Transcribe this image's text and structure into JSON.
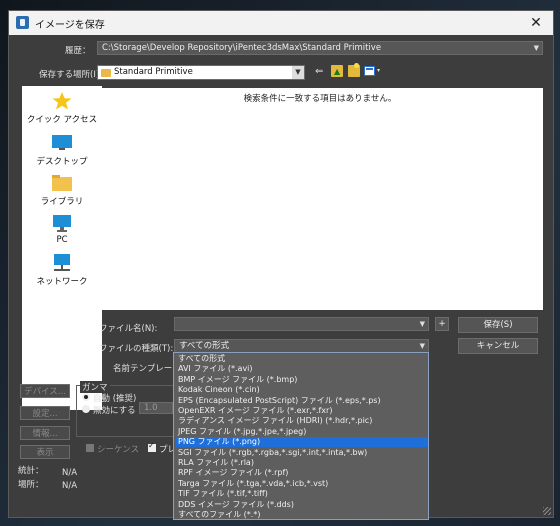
{
  "window": {
    "title": "イメージを保存"
  },
  "history": {
    "label": "履歴：",
    "value": "C:\\Storage\\Develop Repository\\iPentec3dsMax\\Standard Primitive"
  },
  "save_in": {
    "label": "保存する場所(I):",
    "value": "Standard Primitive"
  },
  "places": [
    {
      "label": "クイック アクセス",
      "icon": "star-icon"
    },
    {
      "label": "デスクトップ",
      "icon": "desktop-icon"
    },
    {
      "label": "ライブラリ",
      "icon": "library-folder-icon"
    },
    {
      "label": "PC",
      "icon": "pc-icon"
    },
    {
      "label": "ネットワーク",
      "icon": "network-icon"
    }
  ],
  "file_list": {
    "empty_message": "検索条件に一致する項目はありません。"
  },
  "filename": {
    "label": "ファイル名(N):",
    "value": "",
    "plus": "+",
    "save_button": "保存(S)"
  },
  "filetype": {
    "label": "ファイルの種類(T):",
    "value": "すべての形式",
    "cancel_button": "キャンセル"
  },
  "template": {
    "label": "名前テンプレート:"
  },
  "file_types": [
    "すべての形式",
    "AVI ファイル (*.avi)",
    "BMP イメージ ファイル (*.bmp)",
    "Kodak Cineon (*.cin)",
    "EPS (Encapsulated PostScript) ファイル (*.eps,*.ps)",
    "OpenEXR イメージ ファイル (*.exr,*.fxr)",
    "ラディアンス イメージ ファイル (HDRI) (*.hdr,*.pic)",
    "JPEG ファイル (*.jpg,*.jpe,*.jpeg)",
    "PNG ファイル (*.png)",
    "SGI ファイル (*.rgb,*.rgba,*.sgi,*.int,*.inta,*.bw)",
    "RLA ファイル (*.rla)",
    "RPF イメージ ファイル (*.rpf)",
    "Targa ファイル (*.tga,*.vda,*.icb,*.vst)",
    "TIF ファイル (*.tif,*.tiff)",
    "DDS イメージ ファイル (*.dds)",
    "すべてのファイル (*.*)"
  ],
  "selected_file_type_index": 8,
  "side_buttons": {
    "devices": "デバイス...",
    "setup": "設定...",
    "info": "情報...",
    "view": "表示"
  },
  "gamma": {
    "title": "ガンマ",
    "auto": "自動 (推奨)",
    "override": "無効にする",
    "override_value": "1.0"
  },
  "sequence": {
    "label": "シーケンス",
    "preview_label": "プレ"
  },
  "stats": {
    "stats_label": "統計：",
    "stats_value": "N/A",
    "location_label": "場所：",
    "location_value": "N/A"
  }
}
